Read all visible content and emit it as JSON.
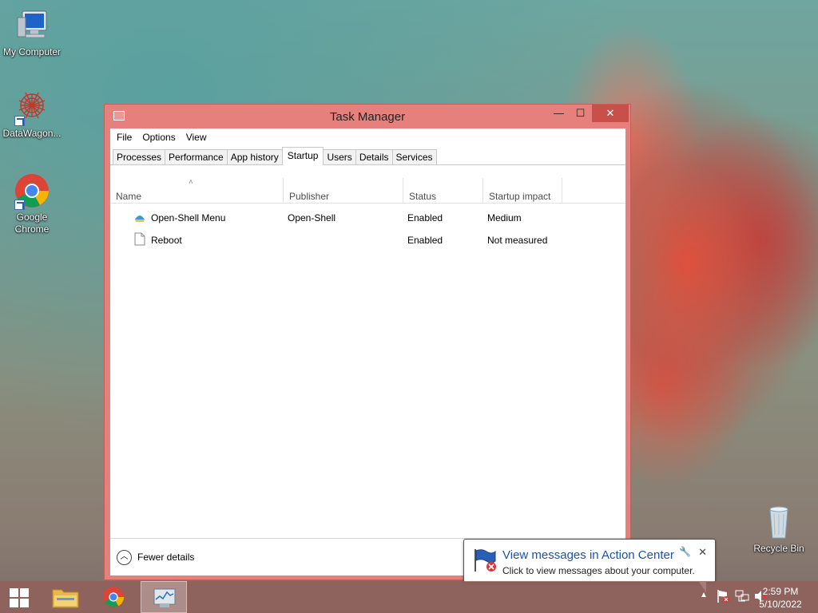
{
  "desktop": {
    "icons": [
      {
        "label": "My Computer",
        "icon": "computer-icon"
      },
      {
        "label": "DataWagon...",
        "icon": "datawagon-icon"
      },
      {
        "label": "Google Chrome",
        "icon": "chrome-icon"
      },
      {
        "label": "Recycle Bin",
        "icon": "recycle-bin-icon"
      }
    ]
  },
  "window": {
    "title": "Task Manager",
    "controls": {
      "minimize": "—",
      "maximize": "☐",
      "close": "✕"
    },
    "menu": [
      "File",
      "Options",
      "View"
    ],
    "tabs": [
      "Processes",
      "Performance",
      "App history",
      "Startup",
      "Users",
      "Details",
      "Services"
    ],
    "active_tab": "Startup",
    "columns": {
      "name": "Name",
      "publisher": "Publisher",
      "status": "Status",
      "impact": "Startup impact"
    },
    "rows": [
      {
        "name": "Open-Shell Menu",
        "publisher": "Open-Shell",
        "status": "Enabled",
        "impact": "Medium",
        "icon": "shell-icon"
      },
      {
        "name": "Reboot",
        "publisher": "",
        "status": "Enabled",
        "impact": "Not measured",
        "icon": "file-icon"
      }
    ],
    "footer": {
      "fewer_details": "Fewer details"
    }
  },
  "notification": {
    "title": "View messages in Action Center",
    "text": "Click to view messages about your computer.",
    "icon": "action-center-flag-icon"
  },
  "taskbar": {
    "items": [
      "start-button",
      "file-explorer",
      "google-chrome",
      "task-manager"
    ],
    "clock": {
      "time": "2:59 PM",
      "date": "5/10/2022"
    }
  }
}
